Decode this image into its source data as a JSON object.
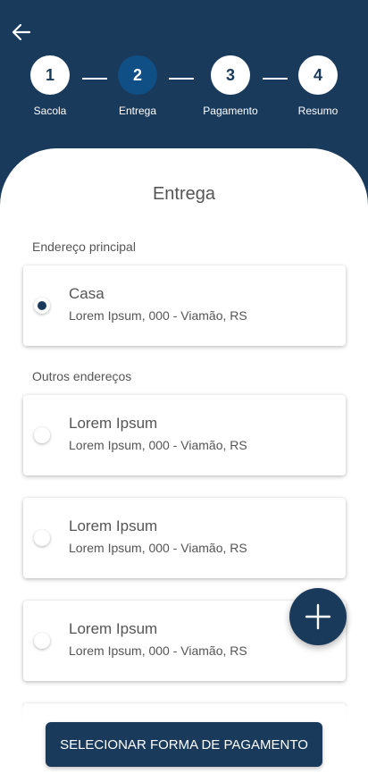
{
  "header": {
    "back_icon": "arrow-left-icon",
    "steps": [
      {
        "number": "1",
        "label": "Sacola",
        "active": false
      },
      {
        "number": "2",
        "label": "Entrega",
        "active": true
      },
      {
        "number": "3",
        "label": "Pagamento",
        "active": false
      },
      {
        "number": "4",
        "label": "Resumo",
        "active": false
      }
    ]
  },
  "main": {
    "title": "Entrega",
    "primary_section_label": "Endereço principal",
    "primary_address": {
      "name": "Casa",
      "address": "Lorem Ipsum, 000 - Viamão, RS",
      "selected": true
    },
    "other_section_label": "Outros endereços",
    "other_addresses": [
      {
        "name": "Lorem Ipsum",
        "address": "Lorem Ipsum, 000 - Viamão, RS",
        "selected": false
      },
      {
        "name": "Lorem Ipsum",
        "address": "Lorem Ipsum, 000 - Viamão, RS",
        "selected": false
      },
      {
        "name": "Lorem Ipsum",
        "address": "Lorem Ipsum, 000 - Viamão, RS",
        "selected": false
      }
    ]
  },
  "fab": {
    "icon": "plus-icon"
  },
  "footer": {
    "cta_label": "SELECIONAR FORMA DE PAGAMENTO"
  },
  "colors": {
    "primary": "#1a3a5c",
    "active_step": "#0f4f86",
    "text": "#555555"
  }
}
